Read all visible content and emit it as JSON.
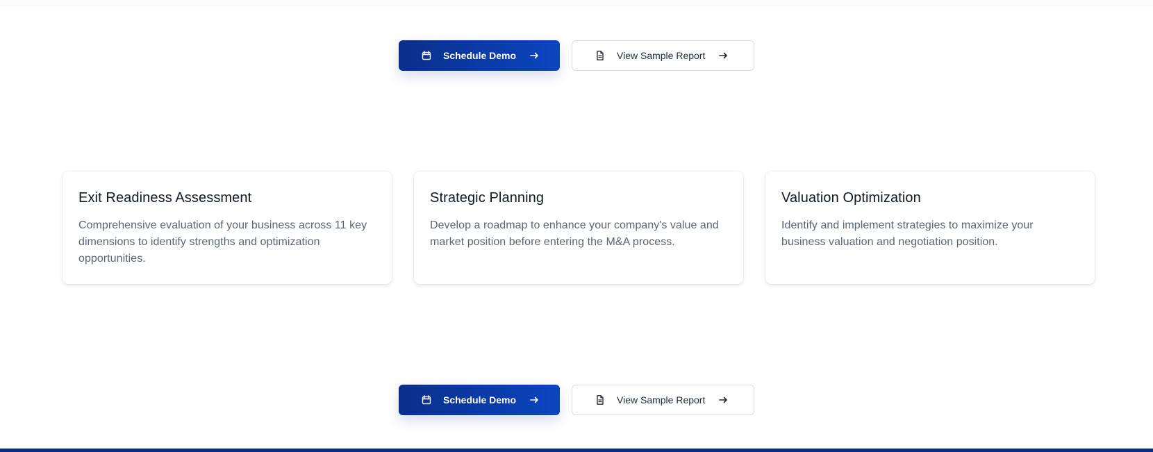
{
  "cta_top": {
    "primary_label": "Schedule Demo",
    "secondary_label": "View Sample Report"
  },
  "cards": [
    {
      "title": "Exit Readiness Assessment",
      "description": "Comprehensive evaluation of your business across 11 key dimensions to identify strengths and optimization opportunities."
    },
    {
      "title": "Strategic Planning",
      "description": "Develop a roadmap to enhance your company's value and market position before entering the M&A process."
    },
    {
      "title": "Valuation Optimization",
      "description": "Identify and implement strategies to maximize your business valuation and negotiation position."
    }
  ],
  "cta_bottom": {
    "primary_label": "Schedule Demo",
    "secondary_label": "View Sample Report"
  },
  "icons": {
    "primary_icon": "calendar-icon",
    "secondary_icon": "document-icon",
    "arrow_icon": "arrow-right-icon"
  },
  "colors": {
    "primary_start": "#0a2f8a",
    "primary_end": "#0b45bf",
    "footer_band": "#0b2e7b",
    "card_text": "#5b6473"
  }
}
